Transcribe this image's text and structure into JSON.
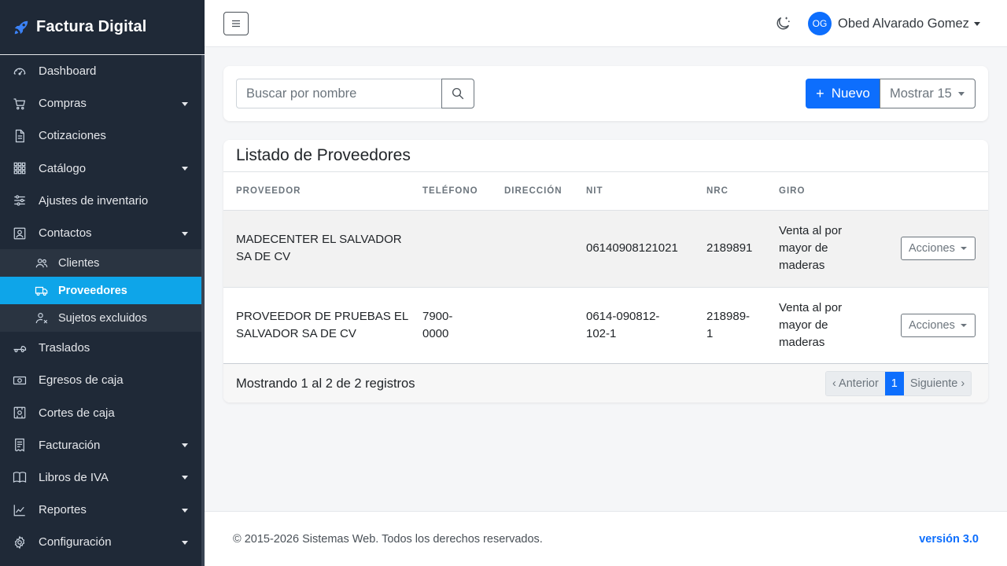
{
  "app": {
    "title": "Factura Digital"
  },
  "sidebar": {
    "items": [
      {
        "label": "Dashboard",
        "icon": "dashboard-icon"
      },
      {
        "label": "Compras",
        "icon": "cart-icon"
      },
      {
        "label": "Cotizaciones",
        "icon": "document-icon"
      },
      {
        "label": "Catálogo",
        "icon": "grid-icon"
      },
      {
        "label": "Ajustes de inventario",
        "icon": "sliders-icon"
      },
      {
        "label": "Contactos",
        "icon": "contacts-icon"
      },
      {
        "label": "Traslados",
        "icon": "truck-icon"
      },
      {
        "label": "Egresos de caja",
        "icon": "cash-icon"
      },
      {
        "label": "Cortes de caja",
        "icon": "cash-cut-icon"
      },
      {
        "label": "Facturación",
        "icon": "receipt-icon"
      },
      {
        "label": "Libros de IVA",
        "icon": "book-icon"
      },
      {
        "label": "Reportes",
        "icon": "chart-icon"
      },
      {
        "label": "Configuración",
        "icon": "gear-icon"
      }
    ],
    "contactos_sub": [
      {
        "label": "Clientes",
        "icon": "people-icon"
      },
      {
        "label": "Proveedores",
        "icon": "truck-icon",
        "active": true
      },
      {
        "label": "Sujetos excluidos",
        "icon": "person-x-icon"
      }
    ]
  },
  "topbar": {
    "user_initials": "OG",
    "user_name": "Obed Alvarado Gomez"
  },
  "search": {
    "placeholder": "Buscar por nombre"
  },
  "toolbar": {
    "new_label": "Nuevo",
    "show_label": "Mostrar 15"
  },
  "table": {
    "title": "Listado de Proveedores",
    "headers": [
      "PROVEEDOR",
      "TELÉFONO",
      "DIRECCIÓN",
      "NIT",
      "NRC",
      "GIRO"
    ],
    "rows": [
      {
        "proveedor": [
          "MADECENTER EL SALVADOR",
          "SA DE CV"
        ],
        "telefono": [
          "",
          ""
        ],
        "direccion": "",
        "nit": [
          "06140908121021",
          ""
        ],
        "nrc": [
          "2189891",
          ""
        ],
        "giro": [
          "Venta al por",
          "mayor de",
          "maderas"
        ],
        "action": "Acciones"
      },
      {
        "proveedor": [
          "PROVEEDOR DE PRUEBAS EL",
          "SALVADOR SA DE CV"
        ],
        "telefono": [
          "7900-",
          "0000"
        ],
        "direccion": "",
        "nit": [
          "0614-090812-",
          "102-1"
        ],
        "nrc": [
          "218989-",
          "1"
        ],
        "giro": [
          "Venta al por",
          "mayor de",
          "maderas"
        ],
        "action": "Acciones"
      }
    ],
    "footer_text": "Mostrando 1 al 2 de 2 registros",
    "pager": {
      "prev": "‹ Anterior",
      "current": "1",
      "next": "Siguiente ›"
    }
  },
  "footer": {
    "copyright": "© 2015-2026 Sistemas Web. Todos los derechos reservados.",
    "version": "versión 3.0"
  },
  "colors": {
    "sidebar_bg": "#1f2937",
    "active": "#0ea5e9",
    "primary": "#0d6efd"
  }
}
